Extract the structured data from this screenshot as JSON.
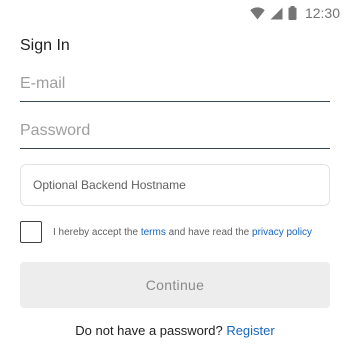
{
  "status_bar": {
    "time": "12:30",
    "icons": [
      "wifi-icon",
      "cell-signal-icon",
      "battery-icon"
    ],
    "color": "#757575"
  },
  "title": "Sign In",
  "email": {
    "placeholder": "E-mail",
    "value": ""
  },
  "password": {
    "placeholder": "Password",
    "value": ""
  },
  "hostname": {
    "placeholder": "Optional Backend Hostname",
    "value": ""
  },
  "terms": {
    "checked": false,
    "prefix": "I hereby accept the",
    "terms_link": "terms",
    "middle": "and have read the",
    "privacy_link": "privacy policy"
  },
  "continue_label": "Continue",
  "register": {
    "prompt": "Do not have a password?",
    "link": "Register"
  },
  "colors": {
    "link": "#1565c0",
    "button_bg": "#ededed",
    "button_text": "#8a8a8a",
    "field_underline": "#37474f"
  }
}
